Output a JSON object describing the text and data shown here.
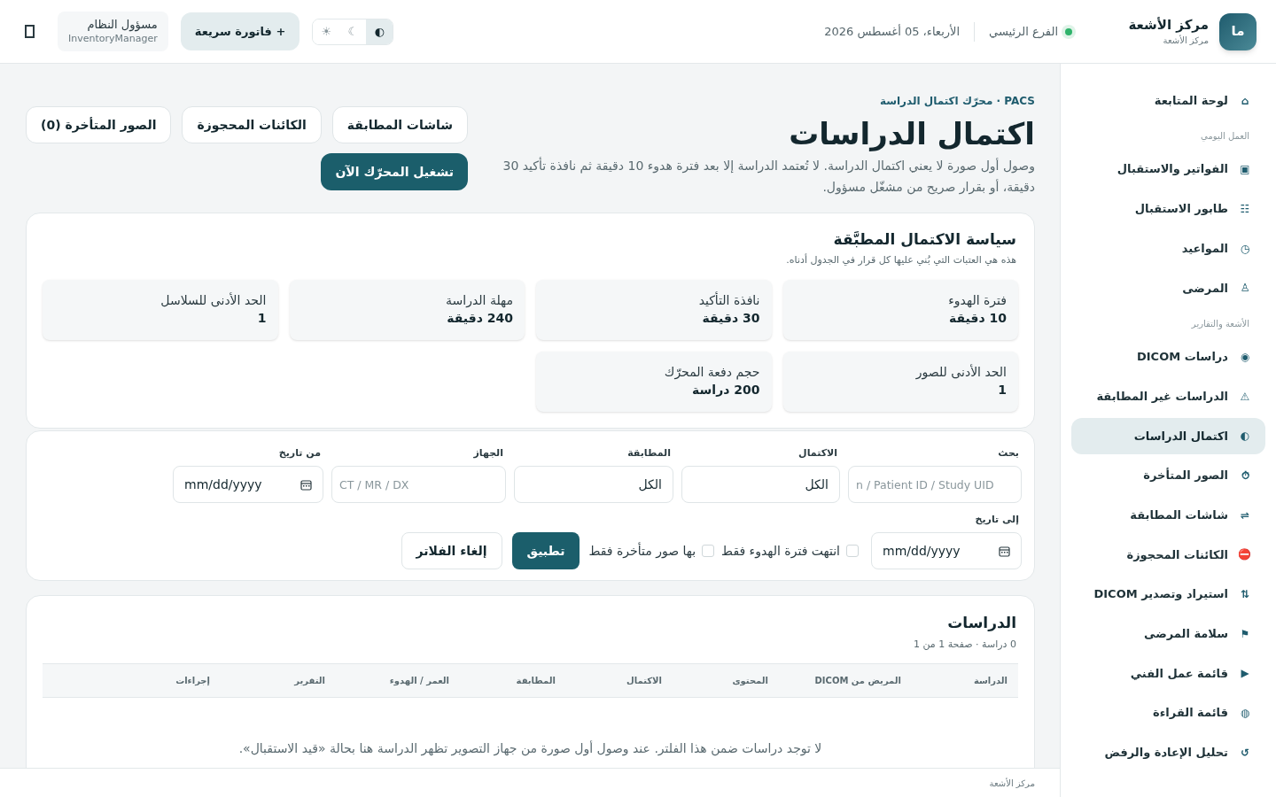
{
  "header": {
    "brand": {
      "logo": "ما",
      "title": "مركز الأشعة",
      "subtitle": "مركز الأشعة"
    },
    "branch": {
      "label": "الفرع الرئيسي",
      "online": true
    },
    "date": "الأربعاء، 05 أغسطس 2026",
    "theme_options": [
      {
        "icon": "◐",
        "selected": true
      },
      {
        "icon": "☾",
        "selected": false
      },
      {
        "icon": "☀",
        "selected": false
      }
    ],
    "quick_invoice": "+ فاتورة سريعة",
    "user": {
      "name": "مسؤول النظام",
      "role": "InventoryManager"
    }
  },
  "sidebar": {
    "sections": [
      {
        "items": [
          {
            "icon": "⌂",
            "label": "لوحة المتابعة",
            "selected": false
          }
        ]
      },
      {
        "heading": "العمل اليومي",
        "items": [
          {
            "icon": "▣",
            "label": "الفواتير والاستقبال",
            "selected": false
          },
          {
            "icon": "☷",
            "label": "طابور الاستقبال",
            "selected": false
          },
          {
            "icon": "◷",
            "label": "المواعيد",
            "selected": false
          },
          {
            "icon": "♙",
            "label": "المرضى",
            "selected": false
          }
        ]
      },
      {
        "heading": "الأشعة والتقارير",
        "items": [
          {
            "icon": "◉",
            "label": "دراسات DICOM",
            "selected": false
          },
          {
            "icon": "⚠",
            "label": "الدراسات غير المطابقة",
            "selected": false
          },
          {
            "icon": "◐",
            "label": "اكتمال الدراسات",
            "selected": true
          },
          {
            "icon": "⏱",
            "label": "الصور المتأخرة",
            "selected": false
          },
          {
            "icon": "⇌",
            "label": "شاشات المطابقة",
            "selected": false
          },
          {
            "icon": "⛔",
            "label": "الكائنات المحجوزة",
            "selected": false
          },
          {
            "icon": "⇅",
            "label": "استيراد وتصدير DICOM",
            "selected": false
          },
          {
            "icon": "⚑",
            "label": "سلامة المرضى",
            "selected": false
          },
          {
            "icon": "▶",
            "label": "قائمة عمل الفني",
            "selected": false
          },
          {
            "icon": "◍",
            "label": "قائمة القراءة",
            "selected": false
          },
          {
            "icon": "↺",
            "label": "تحليل الإعادة والرفض",
            "selected": false
          }
        ]
      }
    ]
  },
  "page": {
    "breadcrumb": "PACS · محرّك اكتمال الدراسة",
    "title": "اكتمال الدراسات",
    "description": "وصول أول صورة لا يعني اكتمال الدراسة. لا تُعتمد الدراسة إلا بعد فترة هدوء 10 دقيقة ثم نافذة تأكيد 30 دقيقة، أو بقرار صريح من مشغّل مسؤول.",
    "links": [
      "شاشات المطابقة",
      "الكائنات المحجوزة",
      "الصور المتأخرة (0)"
    ],
    "run_button": "تشغيل المحرّك الآن"
  },
  "policy": {
    "title": "سياسة الاكتمال المطبَّقة",
    "subtitle": "هذه هي العتبات التي بُني عليها كل قرار في الجدول أدناه.",
    "items": [
      {
        "label": "فترة الهدوء",
        "value": "10 دقيقة"
      },
      {
        "label": "نافذة التأكيد",
        "value": "30 دقيقة"
      },
      {
        "label": "مهلة الدراسة",
        "value": "240 دقيقة"
      },
      {
        "label": "الحد الأدنى للسلاسل",
        "value": "1"
      },
      {
        "label": "الحد الأدنى للصور",
        "value": "1"
      },
      {
        "label": "حجم دفعة المحرّك",
        "value": "200 دراسة"
      }
    ]
  },
  "filters": {
    "fields": [
      {
        "kind": "text",
        "label": "بحث",
        "placeholder": "n / Patient ID / Study UID"
      },
      {
        "kind": "select",
        "label": "الاكتمال",
        "value": "الكل"
      },
      {
        "kind": "select",
        "label": "المطابقة",
        "value": "الكل"
      },
      {
        "kind": "text",
        "label": "الجهاز",
        "placeholder": "CT / MR / DX"
      },
      {
        "kind": "date",
        "label": "من تاريخ",
        "value": "mm/dd/yyyy"
      },
      {
        "kind": "date",
        "label": "إلى تاريخ",
        "value": "mm/dd/yyyy"
      }
    ],
    "checkboxes": [
      {
        "label": "انتهت فترة الهدوء فقط",
        "checked": false
      },
      {
        "label": "بها صور متأخرة فقط",
        "checked": false
      }
    ],
    "apply": "تطبيق",
    "clear": "إلغاء الفلاتر"
  },
  "studies": {
    "title": "الدراسات",
    "summary": "0 دراسة · صفحة 1 من 1",
    "columns": [
      "الدراسة",
      "المريض من DICOM",
      "المحتوى",
      "الاكتمال",
      "المطابقة",
      "العمر / الهدوء",
      "التقرير",
      "إجراءات"
    ],
    "empty": "لا توجد دراسات ضمن هذا الفلتر. عند وصول أول صورة من جهاز التصوير تظهر الدراسة هنا بحالة «قيد الاستقبال»."
  },
  "footer": "مركز الأشعة"
}
